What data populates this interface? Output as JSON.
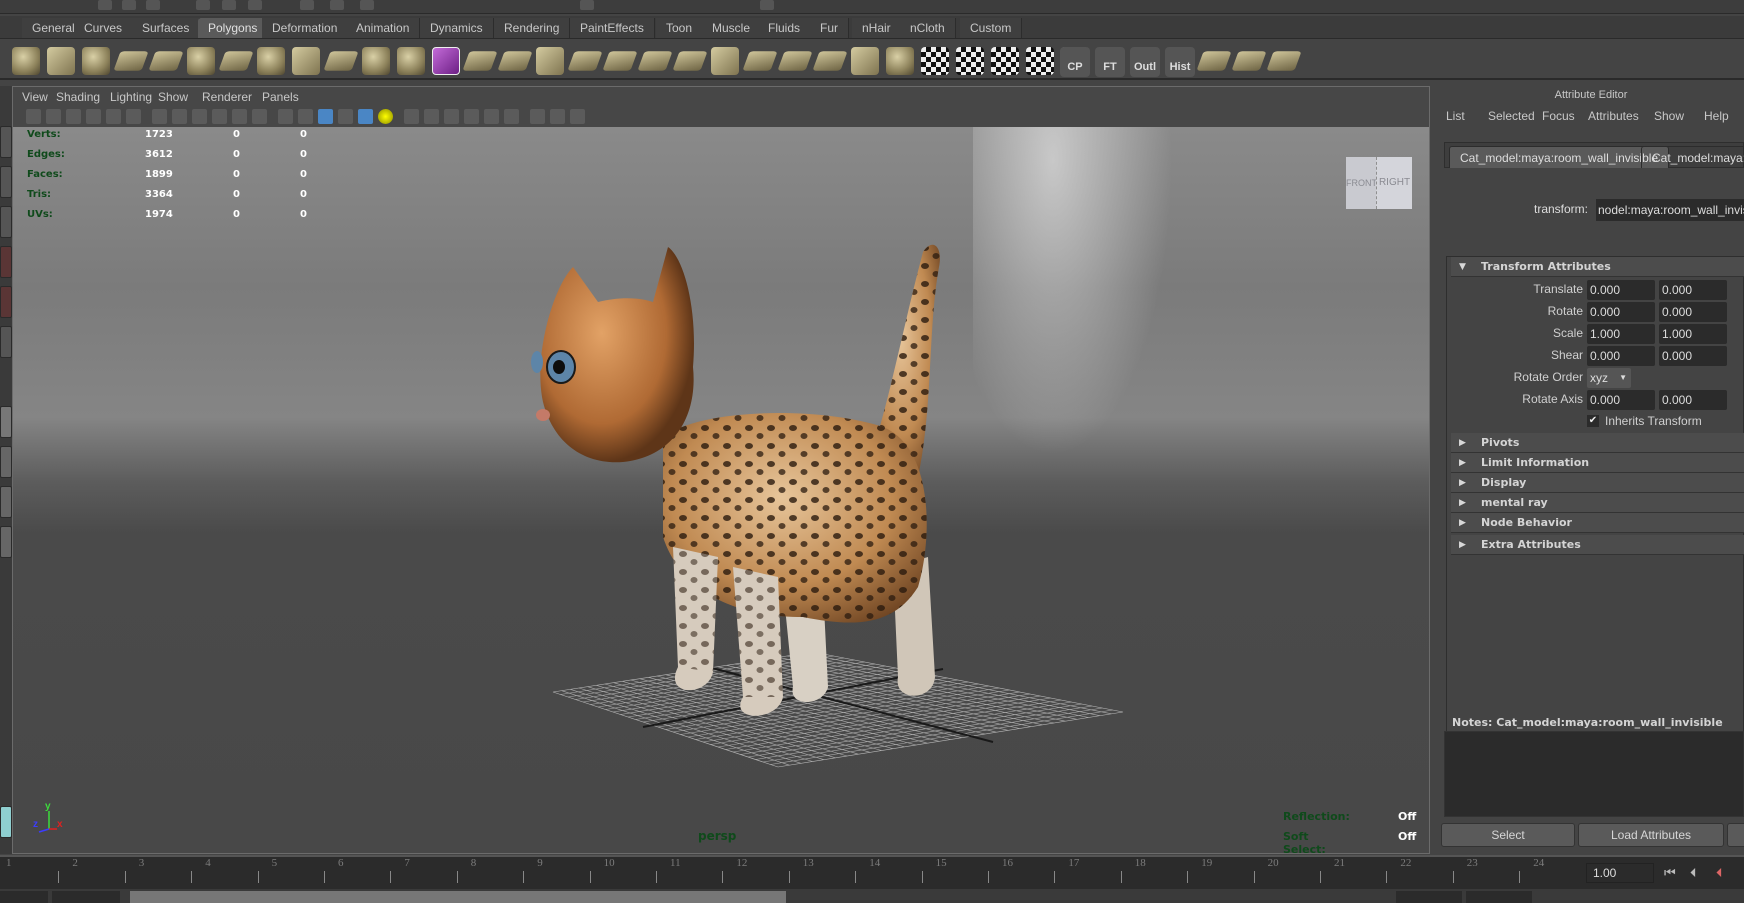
{
  "shelf_tabs": [
    "General",
    "Curves",
    "Surfaces",
    "Polygons",
    "Deformation",
    "Animation",
    "Dynamics",
    "Rendering",
    "PaintEffects",
    "Toon",
    "Muscle",
    "Fluids",
    "Fur",
    "nHair",
    "nCloth",
    "Custom"
  ],
  "shelf_active_tab": "Polygons",
  "shelf_icons": [
    "poly-sphere",
    "poly-cube",
    "poly-cylinder",
    "poly-cone",
    "poly-plane",
    "poly-torus",
    "poly-pyramid",
    "poly-pipe",
    "create-polygon-tool",
    "append-to-polygon",
    "combine",
    "separate",
    "smooth-proxy",
    "mirror-geometry",
    "extract",
    "smooth",
    "bevel",
    "split-polygon",
    "insert-edge-loop",
    "offset-edge-loop",
    "extrude",
    "bridge",
    "merge",
    "wedge",
    "duplicate-face",
    "sculpt",
    "uv-automatic",
    "uv-planar",
    "uv-cylindrical",
    "uv-spherical",
    "uv-texture-editor",
    "center-pivot",
    "freeze-transforms",
    "outliner",
    "history",
    "transfer-uvs",
    "extrude-face",
    "multi-cut"
  ],
  "shelf_text_icons": {
    "cp": "CP",
    "ft": "FT",
    "outl": "Outl",
    "hist": "Hist"
  },
  "viewport_menu": [
    "View",
    "Shading",
    "Lighting",
    "Show",
    "Renderer",
    "Panels"
  ],
  "hud": {
    "rows": [
      {
        "label": "Verts:",
        "values": [
          "1723",
          "0",
          "0"
        ]
      },
      {
        "label": "Edges:",
        "values": [
          "3612",
          "0",
          "0"
        ]
      },
      {
        "label": "Faces:",
        "values": [
          "1899",
          "0",
          "0"
        ]
      },
      {
        "label": "Tris:",
        "values": [
          "3364",
          "0",
          "0"
        ]
      },
      {
        "label": "UVs:",
        "values": [
          "1974",
          "0",
          "0"
        ]
      }
    ],
    "camera": "persp",
    "reflection_label": "Reflection:",
    "reflection_value": "Off",
    "soft_select_label": "Soft Select:",
    "soft_select_value": "Off",
    "viewcube_front": "FRONT",
    "viewcube_right": "RIGHT",
    "axis": {
      "y": "y",
      "z": "z",
      "x": "x"
    }
  },
  "attribute_editor": {
    "title": "Attribute Editor",
    "menu": [
      "List",
      "Selected",
      "Focus",
      "Attributes",
      "Show",
      "Help"
    ],
    "tabs": [
      "Cat_model:maya:room_wall_invisible",
      "Cat_model:maya:r"
    ],
    "transform_label": "transform:",
    "transform_value": "nodel:maya:room_wall_invisible",
    "sections": {
      "transform_attributes": "Transform Attributes",
      "pivots": "Pivots",
      "limit_information": "Limit Information",
      "display": "Display",
      "mental_ray": "mental ray",
      "node_behavior": "Node Behavior",
      "extra_attributes": "Extra Attributes"
    },
    "attrs": {
      "translate": {
        "label": "Translate",
        "v1": "0.000",
        "v2": "0.000"
      },
      "rotate": {
        "label": "Rotate",
        "v1": "0.000",
        "v2": "0.000"
      },
      "scale": {
        "label": "Scale",
        "v1": "1.000",
        "v2": "1.000"
      },
      "shear": {
        "label": "Shear",
        "v1": "0.000",
        "v2": "0.000"
      },
      "rotate_order": {
        "label": "Rotate Order",
        "value": "xyz"
      },
      "rotate_axis": {
        "label": "Rotate Axis",
        "v1": "0.000",
        "v2": "0.000"
      },
      "inherits_transform": {
        "label": "Inherits Transform",
        "checked": true
      }
    },
    "notes_label": "Notes:  Cat_model:maya:room_wall_invisible",
    "buttons": {
      "select": "Select",
      "load_attributes": "Load Attributes"
    }
  },
  "timeline": {
    "ticks": [
      "1",
      "2",
      "3",
      "4",
      "5",
      "6",
      "7",
      "8",
      "9",
      "10",
      "11",
      "12",
      "13",
      "14",
      "15",
      "16",
      "17",
      "18",
      "19",
      "20",
      "21",
      "22",
      "23",
      "24"
    ],
    "current_frame": "1.00"
  }
}
